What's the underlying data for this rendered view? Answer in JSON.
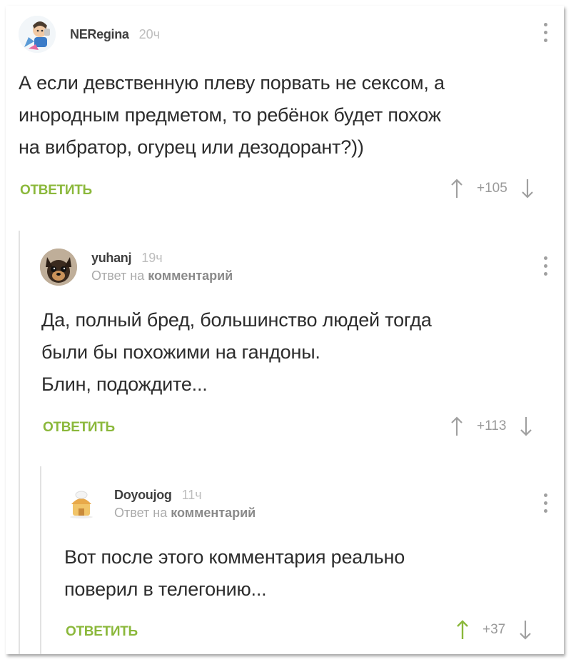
{
  "comments": [
    {
      "username": "NERegina",
      "time": "20ч",
      "reply_to": null,
      "lines": [
        "А если девственную плеву порвать не сексом, а",
        "инородным предметом, то ребёнок будет похож",
        "на вибратор, огурец или дезодорант?))"
      ],
      "reply_label": "ОТВЕТИТЬ",
      "score": "+105",
      "upvoted": false
    },
    {
      "username": "yuhanj",
      "time": "19ч",
      "reply_to": {
        "prefix": "Ответ на",
        "link": "комментарий"
      },
      "lines": [
        "Да, полный бред, большинство людей тогда",
        "были бы похожими на гандоны.",
        "Блин, подождите..."
      ],
      "reply_label": "ОТВЕТИТЬ",
      "score": "+113",
      "upvoted": false
    },
    {
      "username": "Doyoujog",
      "time": "11ч",
      "reply_to": {
        "prefix": "Ответ на",
        "link": "комментарий"
      },
      "lines": [
        "Вот после этого комментария реально",
        "поверил в телегонию..."
      ],
      "reply_label": "ОТВЕТИТЬ",
      "score": "+37",
      "upvoted": true
    }
  ],
  "colors": {
    "accent": "#8bb83b",
    "muted": "#a0a0a0",
    "text": "#2c2c2c"
  },
  "icons": {
    "up": "arrow-up-icon",
    "down": "arrow-down-icon",
    "menu": "kebab-menu-icon"
  }
}
